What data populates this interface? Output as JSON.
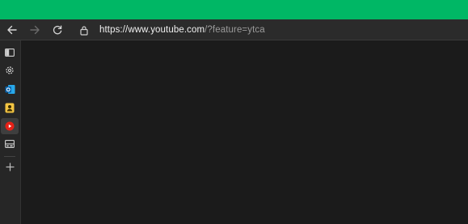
{
  "window": {
    "accent_color": "#00b765"
  },
  "navigation": {
    "back_icon": "arrow-left-icon",
    "forward_icon": "arrow-right-icon",
    "refresh_icon": "refresh-icon"
  },
  "address_bar": {
    "lock_icon": "lock-icon",
    "url_main": "https://www.youtube.com",
    "url_rest": "/?feature=ytca"
  },
  "sidebar": {
    "items": [
      {
        "icon": "tab-icon"
      },
      {
        "icon": "gear-icon"
      },
      {
        "icon": "outlook-icon"
      },
      {
        "icon": "contacts-icon"
      },
      {
        "icon": "youtube-icon",
        "active": true
      },
      {
        "icon": "media-icon"
      },
      {
        "icon": "plus-icon"
      }
    ]
  }
}
